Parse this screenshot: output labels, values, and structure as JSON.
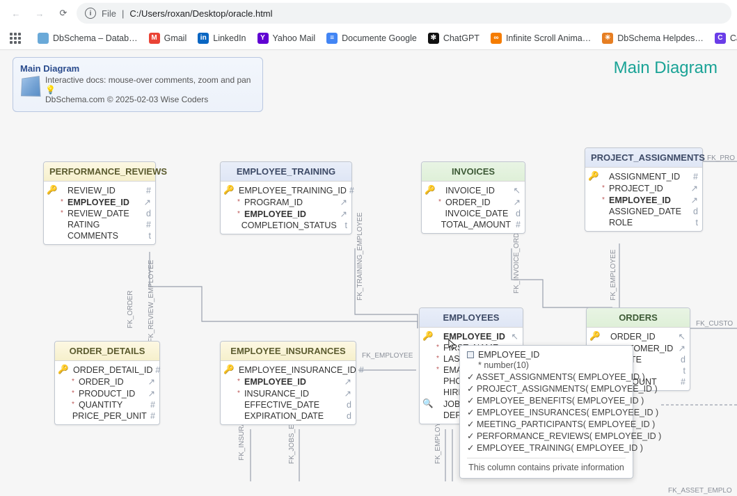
{
  "browser": {
    "url_label": "File",
    "url_path": "C:/Users/roxan/Desktop/oracle.html",
    "bookmarks": [
      {
        "label": "DbSchema – Datab…",
        "color": "#6aa9d8"
      },
      {
        "label": "Gmail",
        "color": "#ea4335",
        "letter": "M"
      },
      {
        "label": "LinkedIn",
        "color": "#0a66c2",
        "letter": "in"
      },
      {
        "label": "Yahoo Mail",
        "color": "#6001d2",
        "letter": "Y"
      },
      {
        "label": "Documente Google",
        "color": "#4285f4",
        "letter": "≡"
      },
      {
        "label": "ChatGPT",
        "color": "#111",
        "letter": "✻"
      },
      {
        "label": "Infinite Scroll Anima…",
        "color": "#f57c00",
        "letter": "∞"
      },
      {
        "label": "DbSchema Helpdes…",
        "color": "#e67e22",
        "letter": "✳"
      },
      {
        "label": "Canva",
        "color": "#6a3de8",
        "letter": "C"
      }
    ]
  },
  "page": {
    "title": "Main Diagram",
    "info_title": "Main Diagram",
    "info_line1": "Interactive docs: mouse-over comments, zoom and pan 💡",
    "info_line2": "DbSchema.com © 2025-02-03 Wise Coders"
  },
  "tables": {
    "performance_reviews": {
      "title": "PERFORMANCE_REVIEWS",
      "rows": [
        {
          "pk": "🔑",
          "req": "",
          "name": "REVIEW_ID",
          "type": "#",
          "bold": false
        },
        {
          "pk": "",
          "req": "*",
          "name": "EMPLOYEE_ID",
          "type": "↗",
          "bold": true
        },
        {
          "pk": "",
          "req": "*",
          "name": "REVIEW_DATE",
          "type": "d",
          "bold": false
        },
        {
          "pk": "",
          "req": "",
          "name": "RATING",
          "type": "#",
          "bold": false
        },
        {
          "pk": "",
          "req": "",
          "name": "COMMENTS",
          "type": "t",
          "bold": false
        }
      ]
    },
    "employee_training": {
      "title": "EMPLOYEE_TRAINING",
      "rows": [
        {
          "pk": "🔑",
          "req": "",
          "name": "EMPLOYEE_TRAINING_ID",
          "type": "#",
          "bold": false
        },
        {
          "pk": "",
          "req": "*",
          "name": "PROGRAM_ID",
          "type": "↗",
          "bold": false
        },
        {
          "pk": "",
          "req": "*",
          "name": "EMPLOYEE_ID",
          "type": "↗",
          "bold": true
        },
        {
          "pk": "",
          "req": "",
          "name": "COMPLETION_STATUS",
          "type": "t",
          "bold": false
        }
      ]
    },
    "invoices": {
      "title": "INVOICES",
      "rows": [
        {
          "pk": "🔑",
          "req": "",
          "name": "INVOICE_ID",
          "type": "↖",
          "bold": false
        },
        {
          "pk": "",
          "req": "*",
          "name": "ORDER_ID",
          "type": "↗",
          "bold": false
        },
        {
          "pk": "",
          "req": "",
          "name": "INVOICE_DATE",
          "type": "d",
          "bold": false
        },
        {
          "pk": "",
          "req": "",
          "name": "TOTAL_AMOUNT",
          "type": "#",
          "bold": false
        }
      ]
    },
    "project_assignments": {
      "title": "PROJECT_ASSIGNMENTS",
      "rows": [
        {
          "pk": "🔑",
          "req": "",
          "name": "ASSIGNMENT_ID",
          "type": "#",
          "bold": false
        },
        {
          "pk": "",
          "req": "*",
          "name": "PROJECT_ID",
          "type": "↗",
          "bold": false
        },
        {
          "pk": "",
          "req": "*",
          "name": "EMPLOYEE_ID",
          "type": "↗",
          "bold": true
        },
        {
          "pk": "",
          "req": "",
          "name": "ASSIGNED_DATE",
          "type": "d",
          "bold": false
        },
        {
          "pk": "",
          "req": "",
          "name": "ROLE",
          "type": "t",
          "bold": false
        }
      ]
    },
    "order_details": {
      "title": "ORDER_DETAILS",
      "rows": [
        {
          "pk": "🔑",
          "req": "",
          "name": "ORDER_DETAIL_ID",
          "type": "#",
          "bold": false
        },
        {
          "pk": "",
          "req": "*",
          "name": "ORDER_ID",
          "type": "↗",
          "bold": false
        },
        {
          "pk": "",
          "req": "*",
          "name": "PRODUCT_ID",
          "type": "↗",
          "bold": false
        },
        {
          "pk": "",
          "req": "*",
          "name": "QUANTITY",
          "type": "#",
          "bold": false
        },
        {
          "pk": "",
          "req": "",
          "name": "PRICE_PER_UNIT",
          "type": "#",
          "bold": false
        }
      ]
    },
    "employee_insurances": {
      "title": "EMPLOYEE_INSURANCES",
      "rows": [
        {
          "pk": "🔑",
          "req": "",
          "name": "EMPLOYEE_INSURANCE_ID",
          "type": "#",
          "bold": false
        },
        {
          "pk": "",
          "req": "*",
          "name": "EMPLOYEE_ID",
          "type": "↗",
          "bold": true
        },
        {
          "pk": "",
          "req": "*",
          "name": "INSURANCE_ID",
          "type": "↗",
          "bold": false
        },
        {
          "pk": "",
          "req": "",
          "name": "EFFECTIVE_DATE",
          "type": "d",
          "bold": false
        },
        {
          "pk": "",
          "req": "",
          "name": "EXPIRATION_DATE",
          "type": "d",
          "bold": false
        }
      ]
    },
    "employees": {
      "title": "EMPLOYEES",
      "rows": [
        {
          "pk": "🔑",
          "req": "",
          "name": "EMPLOYEE_ID",
          "type": "↖",
          "bold": true
        },
        {
          "pk": "",
          "req": "*",
          "name": "FIRST_NAME",
          "type": "",
          "bold": false
        },
        {
          "pk": "",
          "req": "*",
          "name": "LAST_",
          "type": "",
          "bold": false
        },
        {
          "pk": "",
          "req": "*",
          "name": "EMAI",
          "type": "",
          "bold": false
        },
        {
          "pk": "",
          "req": "",
          "name": "PHON",
          "type": "",
          "bold": false
        },
        {
          "pk": "",
          "req": "",
          "name": "HIRE_",
          "type": "",
          "bold": false
        },
        {
          "pk": "🔍",
          "req": "",
          "name": "JOB_I",
          "type": "",
          "bold": false
        },
        {
          "pk": "",
          "req": "",
          "name": "DEPA",
          "type": "",
          "bold": false
        }
      ]
    },
    "orders": {
      "title": "ORDERS",
      "rows": [
        {
          "pk": "🔑",
          "req": "",
          "name": "ORDER_ID",
          "type": "↖",
          "bold": false
        },
        {
          "pk": "",
          "req": "*",
          "name": "CUSTOMER_ID",
          "type": "↗",
          "bold": false
        },
        {
          "pk": "",
          "req": "",
          "name": "…DATE",
          "type": "d",
          "bold": false
        },
        {
          "pk": "",
          "req": "",
          "name": "",
          "type": "t",
          "bold": false
        },
        {
          "pk": "",
          "req": "",
          "name": "…AMOUNT",
          "type": "#",
          "bold": false
        }
      ]
    }
  },
  "tooltip": {
    "header": "EMPLOYEE_ID",
    "sub": "* number(10)",
    "refs": [
      "ASSET_ASSIGNMENTS( EMPLOYEE_ID )",
      "PROJECT_ASSIGNMENTS( EMPLOYEE_ID )",
      "EMPLOYEE_BENEFITS( EMPLOYEE_ID )",
      "EMPLOYEE_INSURANCES( EMPLOYEE_ID )",
      "MEETING_PARTICIPANTS( EMPLOYEE_ID )",
      "PERFORMANCE_REVIEWS( EMPLOYEE_ID )",
      "EMPLOYEE_TRAINING( EMPLOYEE_ID )"
    ],
    "note": "This column contains private information"
  },
  "fk_labels": {
    "fk_order": "FK_ORDER",
    "fk_review_emp": "FK_REVIEW_EMPLOYEE",
    "fk_training_emp": "FK_TRAINING_EMPLOYEE",
    "fk_invoice_order": "FK_INVOICE_ORDER",
    "fk_employee": "FK_EMPLOYEE",
    "fk_jobs_emp": "FK_JOBS_EMPL",
    "fk_insurance": "FK_INSURANCE",
    "fk_custo": "FK_CUSTO",
    "fk_pro": "FK_PRO",
    "fk_asset_emplo": "FK_ASSET_EMPLO",
    "fk_employee2": "FK_EMPLOYEE"
  }
}
